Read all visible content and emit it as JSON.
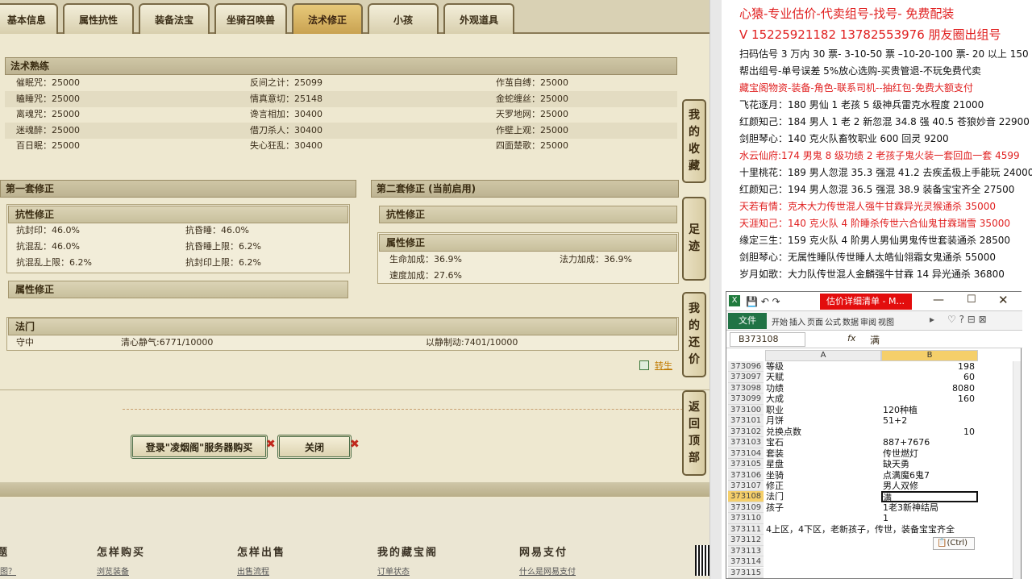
{
  "tabs": [
    {
      "label": "基本信息"
    },
    {
      "label": "属性抗性"
    },
    {
      "label": "装备法宝"
    },
    {
      "label": "坐骑召唤兽"
    },
    {
      "label": "法术修正"
    },
    {
      "label": "小孩"
    },
    {
      "label": "外观道具"
    }
  ],
  "skills": {
    "title": "法术熟练",
    "rows": [
      [
        "催眠咒：25000",
        "反间之计：25099",
        "作茧自缚：25000"
      ],
      [
        "瞌睡咒：25000",
        "情真意切：25148",
        "金蛇缠丝：25000"
      ],
      [
        "离魂咒：25000",
        "谗言相加：30400",
        "天罗地网：25000"
      ],
      [
        "迷魂醉：25000",
        "借刀杀人：30400",
        "作壁上观：25000"
      ],
      [
        "百日眠：25000",
        "失心狂乱：30400",
        "四面楚歌：25000"
      ]
    ]
  },
  "set1": {
    "title": "第一套修正",
    "resist": {
      "title": "抗性修正",
      "rows": [
        [
          "抗封印：46.0%",
          "抗昏睡：46.0%"
        ],
        [
          "抗混乱：46.0%",
          "抗昏睡上限：6.2%"
        ],
        [
          "抗混乱上限：6.2%",
          "抗封印上限：6.2%"
        ]
      ]
    },
    "attr": {
      "title": "属性修正"
    }
  },
  "set2": {
    "title": "第二套修正 (当前启用)",
    "resist": {
      "title": "抗性修正"
    },
    "attr": {
      "title": "属性修正",
      "rows": [
        [
          "生命加成：36.9%",
          "法力加成：36.9%"
        ],
        [
          "速度加成：27.6%",
          ""
        ]
      ]
    }
  },
  "famen": {
    "title": "法门",
    "items": [
      "守中",
      "清心静气:6771/10000",
      "以静制动:7401/10000"
    ]
  },
  "transfer_link": "转生",
  "buttons": {
    "login": "登录\"凌烟阁\"服务器购买",
    "close": "关闭"
  },
  "side_buttons": [
    [
      "我",
      "的",
      "收",
      "藏"
    ],
    [
      "足",
      "迹"
    ],
    [
      "我",
      "的",
      "还",
      "价"
    ],
    [
      "返",
      "回",
      "顶",
      "部"
    ]
  ],
  "footer": {
    "cols": [
      "怎样购买",
      "怎样出售",
      "我的藏宝阁",
      "网易支付"
    ],
    "links": [
      "浏览装备",
      "出售流程",
      "订单状态",
      "什么是网易支付"
    ],
    "partial_left": "题",
    "partial_left2": "图？"
  },
  "right_text": [
    {
      "t": "心猿-专业估价-代卖组号-找号- 免费配装",
      "c": "red",
      "big": true
    },
    {
      "t": "V 15225921182   13782553976 朋友圈出组号",
      "c": "red",
      "big": true
    },
    {
      "t": "扫码估号 3 万内 30 票- 3-10-50 票  –10-20-100 票- 20 以上 150",
      "c": "blk"
    },
    {
      "t": "帮出组号-单号误差 5%放心选购-买贵管退-不玩免费代卖",
      "c": "blk"
    },
    {
      "t": "藏宝阁物资-装备-角色-联系司机--抽红包-免费大额支付",
      "c": "red"
    },
    {
      "t": "飞花逐月：180 男仙 1 老孩 5 级神兵雷克水程度 21000",
      "c": "blk"
    },
    {
      "t": "红颜知己：184 男人 1 老 2 新忽混 34.8 强 40.5 苍狼妙音 22900",
      "c": "blk"
    },
    {
      "t": "剑胆琴心：140 克火队畜牧职业 600 回灵 9200",
      "c": "blk"
    },
    {
      "t": "水云仙府:174 男鬼 8 级功绩 2 老孩子鬼火装一套回血一套 4599",
      "c": "red"
    },
    {
      "t": "十里桃花：189 男人忽混 35.3 强混 41.2 去疾孟极上手能玩 24000",
      "c": "blk"
    },
    {
      "t": "红颜知己：194 男人忽混 36.5 强混 38.9 装备宝宝齐全 27500",
      "c": "blk"
    },
    {
      "t": "天若有情：克木大力传世混人强牛甘霖异光灵猴通杀 35000",
      "c": "red"
    },
    {
      "t": "天涯知己：140 克火队 4 阶睡杀传世六合仙鬼甘霖瑞雪 35000",
      "c": "red"
    },
    {
      "t": "缘定三生：159 克火队 4 阶男人男仙男鬼传世套装通杀 28500",
      "c": "blk"
    },
    {
      "t": "剑胆琴心：无属性睡队传世睡人太皓仙翎霜女鬼通杀 55000",
      "c": "blk"
    },
    {
      "t": "岁月如歌：大力队传世混人金麟强牛甘霖 14 异光通杀 36800",
      "c": "blk"
    }
  ],
  "excel": {
    "title": "估价详细清单 - M...",
    "file_tab": "文件",
    "ribbon": [
      "开始",
      "插入",
      "页面",
      "公式",
      "数据",
      "审阅",
      "视图"
    ],
    "namebox": "B373108",
    "formula": "满",
    "col_a": "A",
    "col_b": "B",
    "clipboard": "(Ctrl)",
    "rows": [
      [
        "373096",
        "等级",
        "198",
        true
      ],
      [
        "373097",
        "天赋",
        "60",
        true
      ],
      [
        "373098",
        "功绩",
        "8080",
        true
      ],
      [
        "373099",
        "大成",
        "160",
        true
      ],
      [
        "373100",
        "职业",
        "120种植",
        false
      ],
      [
        "373101",
        "月饼",
        "51+2",
        false
      ],
      [
        "373102",
        "兑换点数",
        "10",
        true
      ],
      [
        "373103",
        "宝石",
        "887+7676",
        false
      ],
      [
        "373104",
        "套装",
        "传世燃灯",
        false
      ],
      [
        "373105",
        "星盘",
        "缺天勇",
        false
      ],
      [
        "373106",
        "坐骑",
        "点满魔6鬼7",
        false
      ],
      [
        "373107",
        "修正",
        "男人双修",
        false
      ],
      [
        "373108",
        "法门",
        "满",
        false
      ],
      [
        "373109",
        "孩子",
        "1老3新神结局",
        false
      ],
      [
        "373110",
        "",
        "1",
        false
      ],
      [
        "373111",
        "4上区，4下区，老新孩子，传世，装备宝宝齐全",
        "",
        false
      ],
      [
        "373112",
        "",
        "",
        false
      ],
      [
        "373113",
        "",
        "",
        false
      ],
      [
        "373114",
        "",
        "",
        false
      ],
      [
        "373115",
        "",
        "",
        false
      ]
    ]
  }
}
